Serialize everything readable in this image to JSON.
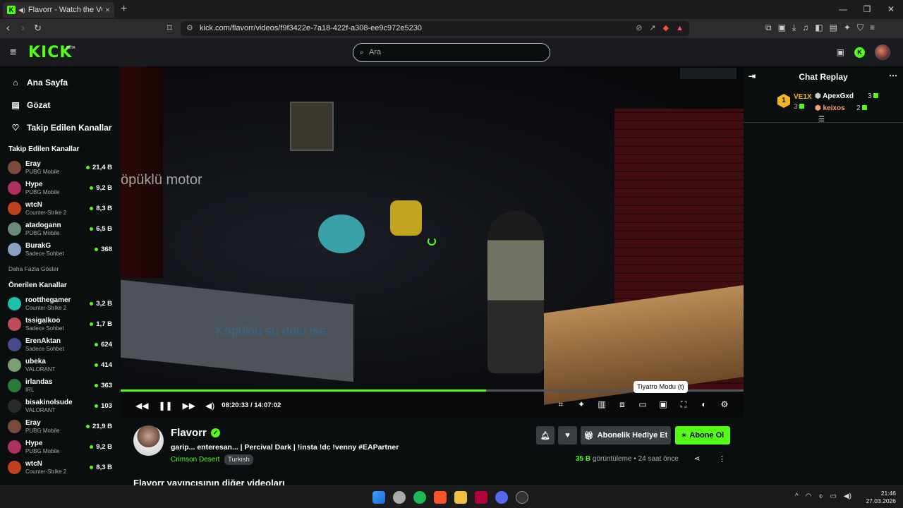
{
  "browser": {
    "tab_title": "Flavorr - Watch the VOD on Kick",
    "url": "kick.com/flavorr/videos/f9f3422e-7a18-422f-a308-ee9c972e5230"
  },
  "header": {
    "logo": "KICK",
    "beta": "BETA",
    "search_placeholder": "Ara"
  },
  "sidebar": {
    "nav": [
      {
        "label": "Ana Sayfa"
      },
      {
        "label": "Gözat"
      },
      {
        "label": "Takip Edilen Kanallar"
      }
    ],
    "followed_title": "Takip Edilen Kanallar",
    "followed": [
      {
        "name": "Eray",
        "category": "PUBG Mobile",
        "viewers": "21,4 B",
        "color": "#7a4a3a"
      },
      {
        "name": "Hype",
        "category": "PUBG Mobile",
        "viewers": "9,2 B",
        "color": "#b03060"
      },
      {
        "name": "wtcN",
        "category": "Counter-Strike 2",
        "viewers": "8,3 B",
        "color": "#c0411d"
      },
      {
        "name": "atadogann",
        "category": "PUBG Mobile",
        "viewers": "6,5 B",
        "color": "#6a8a7a"
      },
      {
        "name": "BurakG",
        "category": "Sadece Sohbet",
        "viewers": "368",
        "color": "#8aa0c0"
      }
    ],
    "show_more": "Daha Fazla Göster",
    "recommended_title": "Önerilen Kanallar",
    "recommended": [
      {
        "name": "rootthegamer",
        "category": "Counter-Strike 2",
        "viewers": "3,2 B",
        "color": "#1dc0a8"
      },
      {
        "name": "tssigalkoo",
        "category": "Sadece Sohbet",
        "viewers": "1,7 B",
        "color": "#c04a5a"
      },
      {
        "name": "ErenAktan",
        "category": "Sadece Sohbet",
        "viewers": "624",
        "color": "#4a4a8a"
      },
      {
        "name": "ubeka",
        "category": "VALORANT",
        "viewers": "414",
        "color": "#7aa070"
      },
      {
        "name": "irlandas",
        "category": "IRL",
        "viewers": "363",
        "color": "#2a7a3a"
      },
      {
        "name": "bisakinolsude",
        "category": "VALORANT",
        "viewers": "103",
        "color": "#2a2a2a"
      },
      {
        "name": "Eray",
        "category": "PUBG Mobile",
        "viewers": "21,9 B",
        "color": "#7a4a3a"
      },
      {
        "name": "Hype",
        "category": "PUBG Mobile",
        "viewers": "9,2 B",
        "color": "#b03060"
      },
      {
        "name": "wtcN",
        "category": "Counter-Strike 2",
        "viewers": "8,3 B",
        "color": "#c0411d"
      }
    ]
  },
  "player": {
    "caption_top": "öpüklü motor",
    "caption_bottom": "Köpüklü su dolu ise",
    "current_time": "08:20:33",
    "separator": "/",
    "duration": "14:07:02",
    "progress": 0.587,
    "tooltip": "Tiyatro Modu (t)"
  },
  "chat": {
    "title": "Chat Replay",
    "leaderboard": {
      "first_name": "VE1X",
      "first_rank": "1",
      "first_count": "3",
      "second_name": "ApexGxd",
      "second_count": "3",
      "third_name": "keixos",
      "third_count": "2"
    }
  },
  "stream": {
    "name": "Flavorr",
    "title": "garip... enteresan... | Percival Dark | !insta !dc !venny #EAPartner",
    "category": "Crimson Desert",
    "language": "Turkish",
    "gift_label": "Abonelik Hediye Et",
    "subscribe_label": "Abone Ol",
    "views": "35 B",
    "views_label": "görüntüleme",
    "dot": "•",
    "ago": "24 saat önce",
    "other_videos": "Flavorr yayıncısının diğer videoları"
  },
  "taskbar": {
    "time": "21:46",
    "date": "27.03.2026"
  }
}
